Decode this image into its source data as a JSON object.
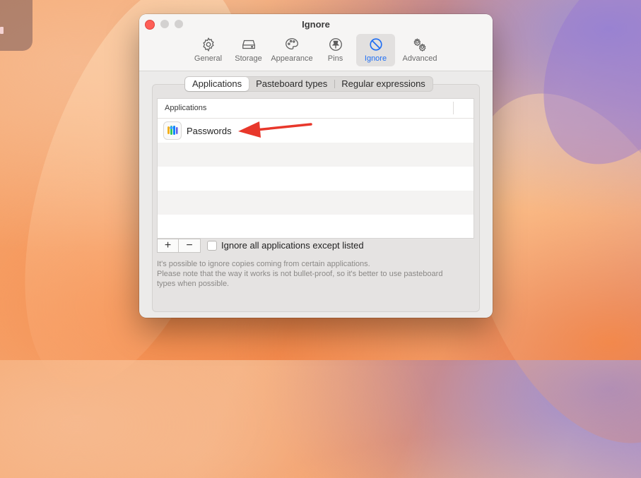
{
  "window": {
    "title": "Ignore"
  },
  "toolbar": {
    "items": [
      {
        "label": "General",
        "icon": "gear-icon"
      },
      {
        "label": "Storage",
        "icon": "storage-drive-icon"
      },
      {
        "label": "Appearance",
        "icon": "palette-icon"
      },
      {
        "label": "Pins",
        "icon": "pin-icon"
      },
      {
        "label": "Ignore",
        "icon": "prohibited-icon",
        "active": true
      },
      {
        "label": "Advanced",
        "icon": "gears-icon"
      }
    ]
  },
  "tabs": {
    "items": [
      {
        "label": "Applications",
        "selected": true
      },
      {
        "label": "Pasteboard types"
      },
      {
        "label": "Regular expressions"
      }
    ]
  },
  "table": {
    "header": "Applications",
    "rows": [
      {
        "name": "Passwords",
        "icon": "passwords-app-icon"
      }
    ]
  },
  "controls": {
    "add_label": "+",
    "remove_label": "−",
    "checkbox_label": "Ignore all applications except listed",
    "checkbox_checked": false
  },
  "note": {
    "line1": "It's possible to ignore copies coming from certain applications.",
    "line2": "Please note that the way it works is not bullet-proof, so it's better to use pasteboard",
    "line3": "types when possible."
  },
  "colors": {
    "accent": "#1f6ef3",
    "annotation_arrow": "#e8372b",
    "close_button": "#fe5f57"
  }
}
